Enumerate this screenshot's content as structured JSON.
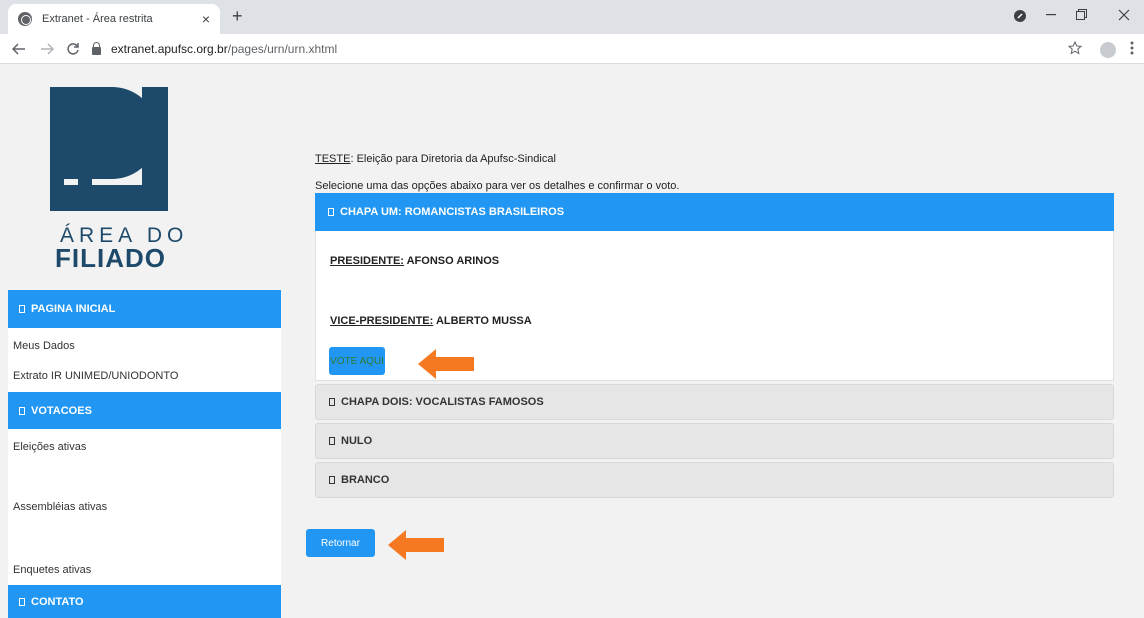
{
  "browser": {
    "tab_title": "Extranet - Área restrita",
    "tab_close": "×",
    "new_tab": "+",
    "url_host": "extranet.apufsc.org.br",
    "url_path": "/pages/urn/urn.xhtml"
  },
  "logo": {
    "line1": "ÁREA DO",
    "line2": "FILIADO",
    "color": "#1d4a6b"
  },
  "sidebar": {
    "sections": [
      {
        "header": "PAGINA INICIAL",
        "links": [
          "Meus Dados",
          "Extrato IR UNIMED/UNIODONTO"
        ]
      },
      {
        "header": "VOTACOES",
        "links": [
          "Eleições ativas",
          "Assembléias ativas",
          "Enquetes ativas"
        ]
      },
      {
        "header": "CONTATO",
        "links": []
      }
    ]
  },
  "main": {
    "title_prefix": "TESTE",
    "title_rest": ": Eleição para Diretoria da Apufsc-Sindical",
    "subtitle": "Selecione uma das opções abaixo para ver os detalhes e confirmar o voto.",
    "options": [
      {
        "label": "CHAPA UM: ROMANCISTAS BRASILEIROS",
        "president_role": "PRESIDENTE:",
        "president_name": " AFONSO ARINOS",
        "vice_role": "VICE-PRESIDENTE:",
        "vice_name": " ALBERTO MUSSA",
        "vote_label": "VOTE AQUI"
      },
      {
        "label": "CHAPA DOIS: VOCALISTAS FAMOSOS"
      },
      {
        "label": "NULO"
      },
      {
        "label": "BRANCO"
      }
    ],
    "return_label": "Retornar"
  },
  "colors": {
    "accent": "#2196f3",
    "arrow": "#f47920"
  }
}
